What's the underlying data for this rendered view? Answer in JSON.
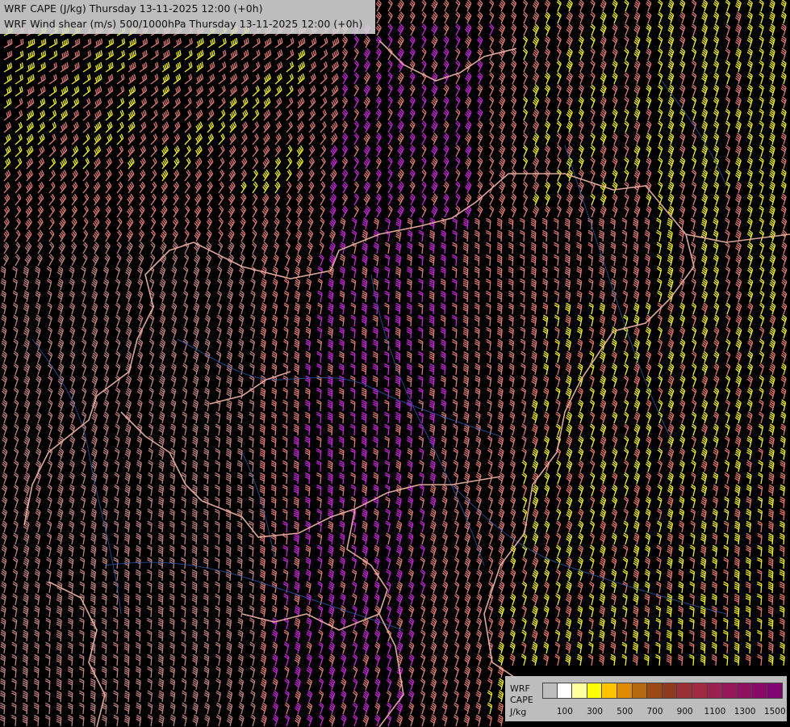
{
  "titles": {
    "line1": "WRF CAPE (J/kg) Thursday 13-11-2025 12:00 (+0h)",
    "line2": "WRF Wind shear (m/s) 500/1000hPa Thursday 13-11-2025 12:00 (+0h)"
  },
  "legend": {
    "label1": "WRF",
    "label2": "CAPE",
    "label3": "J/kg",
    "tick_labels": [
      "100",
      "300",
      "500",
      "700",
      "900",
      "1100",
      "1300",
      "1500"
    ],
    "colors": [
      "#bdbdbd",
      "#ffffff",
      "#ffffa0",
      "#ffff00",
      "#ffc400",
      "#e08a00",
      "#b86a10",
      "#9a4a14",
      "#8e3a1e",
      "#9a3036",
      "#a02a40",
      "#9c2050",
      "#96185a",
      "#8e1060",
      "#880a66",
      "#820470"
    ]
  },
  "colors": {
    "background": "#000000",
    "barb_pink": "#e07a78",
    "barb_salmon": "#e87868",
    "barb_magenta": "#d020e0",
    "barb_yellow": "#f4f400",
    "barb_dusty": "#c08080",
    "border": "#e8b0a0",
    "river": "#2a5ab0"
  },
  "icons": {
    "wind_barb": "wind-barb-icon"
  }
}
